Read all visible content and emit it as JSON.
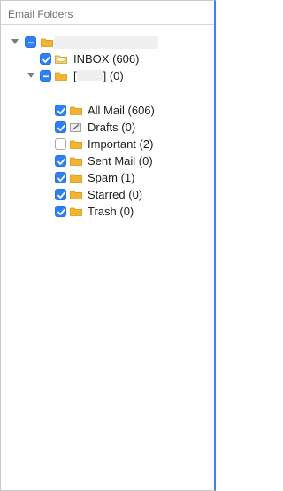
{
  "header": {
    "title": "Email Folders"
  },
  "tree": {
    "account": {
      "name": ""
    },
    "inbox": {
      "label": "INBOX (606)"
    },
    "gmail": {
      "prefix": "[",
      "suffix": "] (0)"
    },
    "children": [
      {
        "label": "All Mail (606)",
        "checked": true
      },
      {
        "label": "Drafts (0)",
        "checked": true
      },
      {
        "label": "Important (2)",
        "checked": false
      },
      {
        "label": "Sent Mail (0)",
        "checked": true
      },
      {
        "label": "Spam (1)",
        "checked": true
      },
      {
        "label": "Starred (0)",
        "checked": true
      },
      {
        "label": "Trash (0)",
        "checked": true
      }
    ]
  },
  "colors": {
    "checkbox_accent": "#2f80f4",
    "folder": "#f2b431",
    "selection_edge": "#3b82f6"
  },
  "icons": {
    "disclosure": "disclosure-triangle-down",
    "folder": "folder-icon",
    "inbox": "inbox-icon",
    "drafts": "drafts-icon"
  }
}
